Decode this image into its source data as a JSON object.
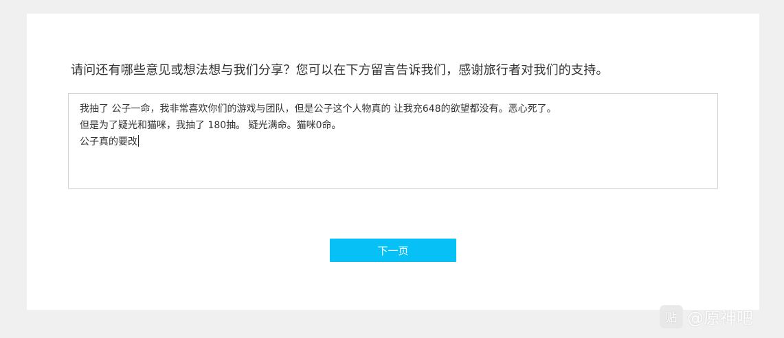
{
  "survey": {
    "question": "请问还有哪些意见或想法想与我们分享？您可以在下方留言告诉我们，感谢旅行者对我们的支持。",
    "answer_lines": [
      "我抽了 公子一命，我非常喜欢你们的游戏与团队，但是公子这个人物真的 让我充648的欲望都没有。恶心死了。",
      "但是为了疑光和猫咪，我抽了 180抽。  疑光满命。猫咪0命。",
      "公子真的要改"
    ],
    "next_button_label": "下一页"
  },
  "watermark": {
    "logo_text": "贴",
    "text": "@原神吧"
  },
  "colors": {
    "page_background": "#f0f0f0",
    "card_background": "#ffffff",
    "button_accent": "#07c0f6"
  }
}
